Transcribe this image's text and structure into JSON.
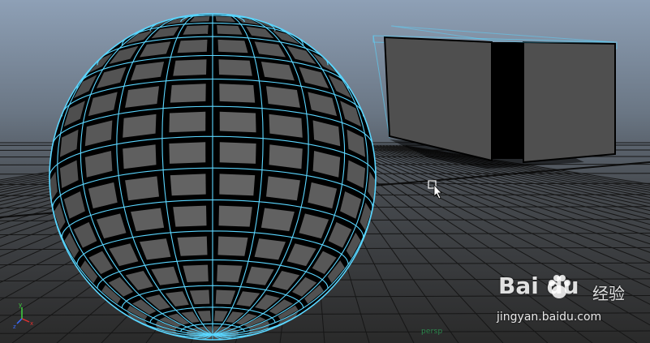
{
  "viewport": {
    "camera_label": "persp",
    "background_top": "#8fa0b5",
    "background_bottom": "#2b2b2b",
    "grid_color": "#1a1a1a",
    "selection_color": "#5ad6ff",
    "face_color": "#5a5a5a"
  },
  "axis_gizmo": {
    "x": "x",
    "y": "y",
    "z": "z"
  },
  "objects": [
    {
      "name": "sphere",
      "selected": true,
      "display": "wireframe-on-shaded"
    },
    {
      "name": "box",
      "selected": false,
      "display": "shaded"
    }
  ],
  "cursor": {
    "icon": "select-arrow-icon"
  },
  "watermark": {
    "brand": "Bai du",
    "cn_text": "经验",
    "url": "jingyan.baidu.com"
  }
}
